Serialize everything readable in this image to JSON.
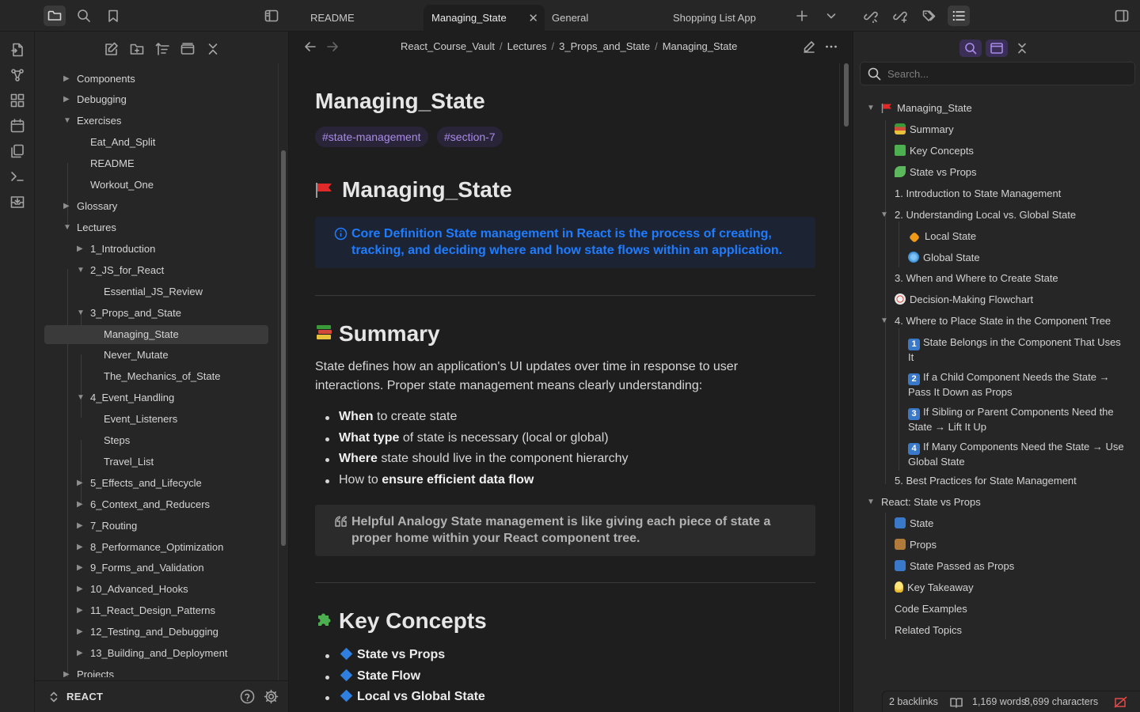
{
  "tabs": [
    {
      "label": "README"
    },
    {
      "label": "Managing_State",
      "active": true
    },
    {
      "label": "General"
    },
    {
      "label": "Shopping List App"
    }
  ],
  "explorer": {
    "vault_name": "REACT",
    "items": [
      {
        "label": "Components",
        "expanded": false
      },
      {
        "label": "Debugging",
        "expanded": false
      },
      {
        "label": "Exercises",
        "expanded": true
      },
      {
        "label": "Eat_And_Split"
      },
      {
        "label": "README"
      },
      {
        "label": "Workout_One"
      },
      {
        "label": "Glossary",
        "expanded": false
      },
      {
        "label": "Lectures",
        "expanded": true
      },
      {
        "label": "1_Introduction",
        "expanded": false
      },
      {
        "label": "2_JS_for_React",
        "expanded": true
      },
      {
        "label": "Essential_JS_Review"
      },
      {
        "label": "3_Props_and_State",
        "expanded": true
      },
      {
        "label": "Managing_State",
        "selected": true
      },
      {
        "label": "Never_Mutate"
      },
      {
        "label": "The_Mechanics_of_State"
      },
      {
        "label": "4_Event_Handling",
        "expanded": true
      },
      {
        "label": "Event_Listeners"
      },
      {
        "label": "Steps"
      },
      {
        "label": "Travel_List"
      },
      {
        "label": "5_Effects_and_Lifecycle",
        "expanded": false
      },
      {
        "label": "6_Context_and_Reducers",
        "expanded": false
      },
      {
        "label": "7_Routing",
        "expanded": false
      },
      {
        "label": "8_Performance_Optimization",
        "expanded": false
      },
      {
        "label": "9_Forms_and_Validation",
        "expanded": false
      },
      {
        "label": "10_Advanced_Hooks",
        "expanded": false
      },
      {
        "label": "11_React_Design_Patterns",
        "expanded": false
      },
      {
        "label": "12_Testing_and_Debugging",
        "expanded": false
      },
      {
        "label": "13_Building_and_Deployment",
        "expanded": false
      },
      {
        "label": "Projects",
        "expanded": false
      }
    ]
  },
  "breadcrumb": [
    "React_Course_Vault",
    "Lectures",
    "3_Props_and_State",
    "Managing_State"
  ],
  "note": {
    "title": "Managing_State",
    "tags": [
      "#state-management",
      "#section-7"
    ],
    "h1": "Managing_State",
    "callout_label": "Core Definition",
    "callout_text": "State management in React is the process of creating, tracking, and deciding where and how state flows within an application.",
    "summary_heading": "Summary",
    "summary_intro": "State defines how an application's UI updates over time in response to user interactions. Proper state management means clearly understanding:",
    "summary_bullets": [
      {
        "bold": "When",
        "rest": " to create state"
      },
      {
        "bold": "What type",
        "rest": " of state is necessary (local or global)"
      },
      {
        "bold": "Where",
        "rest": " state should live in the component hierarchy"
      },
      {
        "pre": "How to ",
        "bold": "ensure efficient data flow",
        "rest": ""
      }
    ],
    "quote_label": "Helpful Analogy",
    "quote_text": "State management is like giving each piece of state a proper home within your React component tree.",
    "key_heading": "Key Concepts",
    "key_items": [
      "State vs Props",
      "State Flow",
      "Local vs Global State"
    ]
  },
  "outline": {
    "search_placeholder": "Search...",
    "items": [
      {
        "label": "Managing_State",
        "emoji": "red-flag"
      },
      {
        "label": "Summary",
        "emoji": "books"
      },
      {
        "label": "Key Concepts",
        "emoji": "puzzle"
      },
      {
        "label": "State vs Props",
        "emoji": "seedling"
      },
      {
        "label": "1. Introduction to State Management"
      },
      {
        "label": "2. Understanding Local vs. Global State"
      },
      {
        "label": "Local State",
        "emoji": "orange-diamond"
      },
      {
        "label": "Global State",
        "emoji": "globe"
      },
      {
        "label": "3. When and Where to Create State"
      },
      {
        "label": "Decision-Making Flowchart",
        "emoji": "compass"
      },
      {
        "label": "4. Where to Place State in the Component Tree"
      },
      {
        "num": "1",
        "label": "State Belongs in the Component That Uses It"
      },
      {
        "num": "2",
        "label": "If a Child Component Needs the State → Pass It Down as Props"
      },
      {
        "num": "3",
        "label": "If Sibling or Parent Components Need the State → Lift It Up"
      },
      {
        "num": "4",
        "label": "If Many Components Need the State → Use Global State"
      },
      {
        "label": "5. Best Practices for State Management"
      },
      {
        "label": "React: State vs Props"
      },
      {
        "label": "State",
        "emoji": "repeat"
      },
      {
        "label": "Props",
        "emoji": "package"
      },
      {
        "label": "State Passed as Props",
        "emoji": "arrows"
      },
      {
        "label": "Key Takeaway",
        "emoji": "bulb"
      },
      {
        "label": "Code Examples"
      },
      {
        "label": "Related Topics"
      }
    ]
  },
  "status": {
    "backlinks": "2 backlinks",
    "words": "1,169 words",
    "chars": "8,699 characters"
  },
  "colors": {
    "accent": "#a88be8",
    "callout_blue": "#1f7cff",
    "background": "#1e1e1e",
    "panel": "#262626"
  }
}
